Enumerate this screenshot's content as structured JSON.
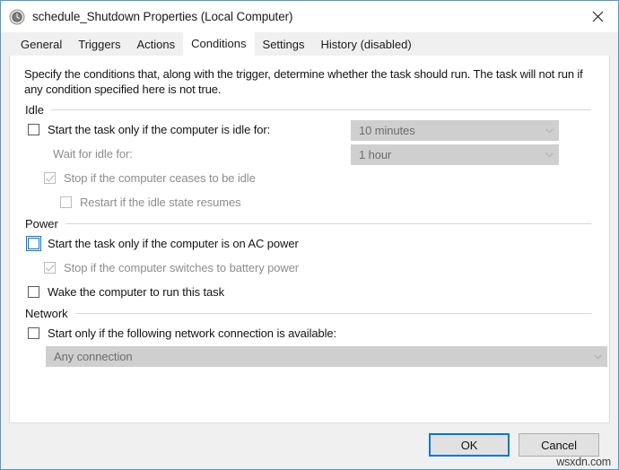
{
  "window": {
    "title": "schedule_Shutdown Properties (Local Computer)",
    "icon": "clock-icon",
    "close_label": "✕",
    "border_color": "#4a9ad4"
  },
  "tabs": [
    {
      "label": "General",
      "active": false
    },
    {
      "label": "Triggers",
      "active": false
    },
    {
      "label": "Actions",
      "active": false
    },
    {
      "label": "Conditions",
      "active": true
    },
    {
      "label": "Settings",
      "active": false
    },
    {
      "label": "History (disabled)",
      "active": false
    }
  ],
  "conditions": {
    "description": "Specify the conditions that, along with the trigger, determine whether the task should run.  The task will not run  if any condition specified here is not true.",
    "idle": {
      "title": "Idle",
      "start_when_idle_label": "Start the task only if the computer is idle for:",
      "start_when_idle_checked": false,
      "idle_duration_value": "10 minutes",
      "wait_for_idle_label": "Wait for idle for:",
      "wait_for_idle_value": "1 hour",
      "stop_when_not_idle_label": "Stop if the computer ceases to be idle",
      "stop_when_not_idle_checked": true,
      "restart_on_idle_label": "Restart if the idle state resumes",
      "restart_on_idle_checked": false
    },
    "power": {
      "title": "Power",
      "ac_power_label": "Start the task only if the computer is on AC power",
      "ac_power_checked": false,
      "stop_on_battery_label": "Stop if the computer switches to battery power",
      "stop_on_battery_checked": true,
      "wake_computer_label": "Wake the computer to run this task",
      "wake_computer_checked": false
    },
    "network": {
      "title": "Network",
      "start_on_network_label": "Start only if the following network connection is available:",
      "start_on_network_checked": false,
      "connection_value": "Any connection"
    }
  },
  "footer": {
    "ok_label": "OK",
    "cancel_label": "Cancel",
    "accent_color": "#0078d7"
  },
  "watermark": "wsxdn.com"
}
